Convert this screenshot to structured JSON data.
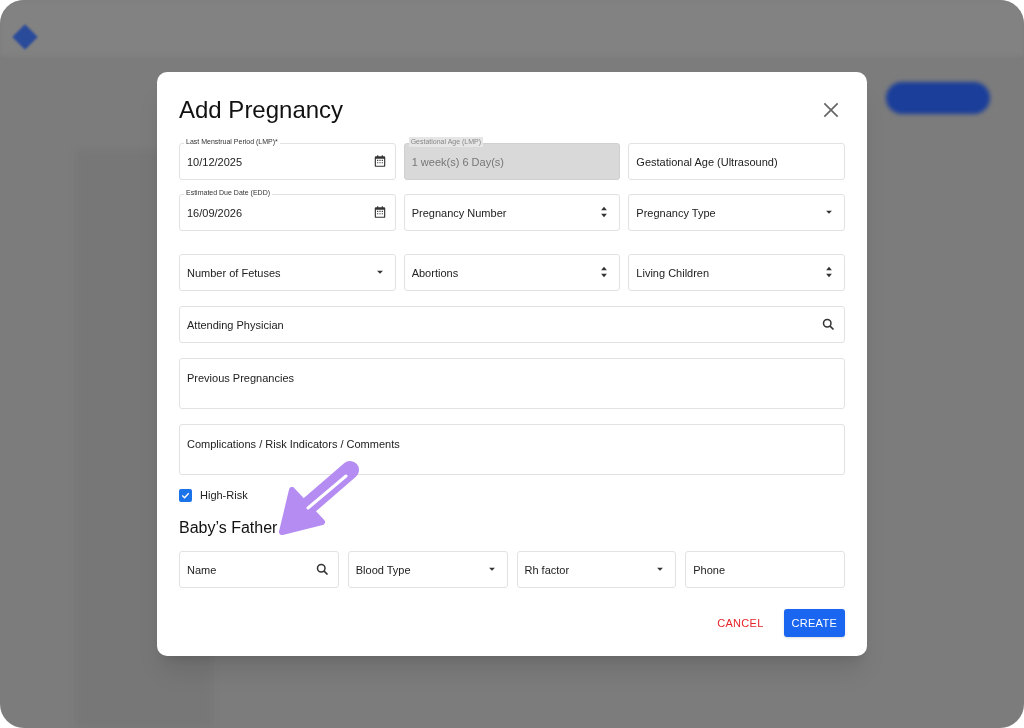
{
  "modal": {
    "title": "Add Pregnancy",
    "rows": [
      {
        "fields": [
          {
            "kind": "date",
            "label": "Last Menstrual Period (LMP)*",
            "value": "10/12/2025",
            "disabled": false
          },
          {
            "kind": "text",
            "label": "Gestational Age (LMP)",
            "value": "1 week(s) 6 Day(s)",
            "disabled": true
          },
          {
            "kind": "text",
            "placeholder": "Gestational Age (Ultrasound)",
            "disabled": false
          }
        ]
      },
      {
        "fields": [
          {
            "kind": "date",
            "label": "Estimated Due Date (EDD)",
            "value": "16/09/2026",
            "disabled": false
          },
          {
            "kind": "number",
            "placeholder": "Pregnancy Number",
            "disabled": false
          },
          {
            "kind": "select",
            "placeholder": "Pregnancy Type",
            "disabled": false
          }
        ]
      },
      {
        "fields": [
          {
            "kind": "select",
            "placeholder": "Number of Fetuses",
            "disabled": false
          },
          {
            "kind": "number",
            "placeholder": "Abortions",
            "disabled": false
          },
          {
            "kind": "number",
            "placeholder": "Living Children",
            "disabled": false
          }
        ]
      },
      {
        "fields": [
          {
            "kind": "search",
            "placeholder": "Attending Physician",
            "disabled": false
          }
        ]
      },
      {
        "fields": [
          {
            "kind": "textarea",
            "placeholder": "Previous Pregnancies",
            "disabled": false
          }
        ]
      },
      {
        "fields": [
          {
            "kind": "textarea",
            "placeholder": "Complications / Risk Indicators / Comments",
            "disabled": false
          }
        ]
      }
    ],
    "high_risk": {
      "label": "High-Risk",
      "checked": true
    },
    "father": {
      "heading": "Baby’s Father",
      "fields": [
        {
          "kind": "search",
          "placeholder": "Name",
          "disabled": false
        },
        {
          "kind": "select",
          "placeholder": "Blood Type",
          "disabled": false
        },
        {
          "kind": "select",
          "placeholder": "Rh factor",
          "disabled": false
        },
        {
          "kind": "text",
          "placeholder": "Phone",
          "disabled": false
        }
      ]
    },
    "buttons": [
      {
        "kind": "text",
        "label": "CANCEL"
      },
      {
        "kind": "primary",
        "label": "CREATE"
      }
    ]
  }
}
